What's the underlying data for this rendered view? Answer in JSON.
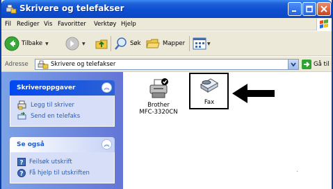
{
  "window": {
    "title": "Skrivere og telefakser",
    "buttons": {
      "minimize": "minimize",
      "maximize": "maximize",
      "close": "close"
    }
  },
  "menubar": {
    "items": [
      "Fil",
      "Rediger",
      "Vis",
      "Favoritter",
      "Verktøy",
      "Hjelp"
    ]
  },
  "toolbar": {
    "back_label": "Tilbake",
    "search_label": "Søk",
    "folders_label": "Mapper"
  },
  "address": {
    "label": "Adresse",
    "value": "Skrivere og telefakser",
    "go_label": "Gå til"
  },
  "taskpane": {
    "printer_tasks": {
      "title": "Skriveroppgaver",
      "items": [
        {
          "label": "Legg til skriver",
          "icon": "add-printer-icon"
        },
        {
          "label": "Send en telefaks",
          "icon": "send-fax-icon"
        }
      ]
    },
    "see_also": {
      "title": "Se også",
      "items": [
        {
          "label": "Feilsøk utskrift",
          "icon": "help-icon"
        },
        {
          "label": "Få hjelp til utskriften",
          "icon": "help-circle-icon"
        }
      ]
    }
  },
  "items": [
    {
      "name_line1": "Brother",
      "name_line2": "MFC-3320CN",
      "icon": "printer-icon",
      "default": true
    },
    {
      "name_line1": "Fax",
      "icon": "fax-icon"
    }
  ],
  "colors": {
    "titlebar": "#0E4FD1",
    "taskpane_bg": "#7BA2E7",
    "link": "#215DC6"
  }
}
